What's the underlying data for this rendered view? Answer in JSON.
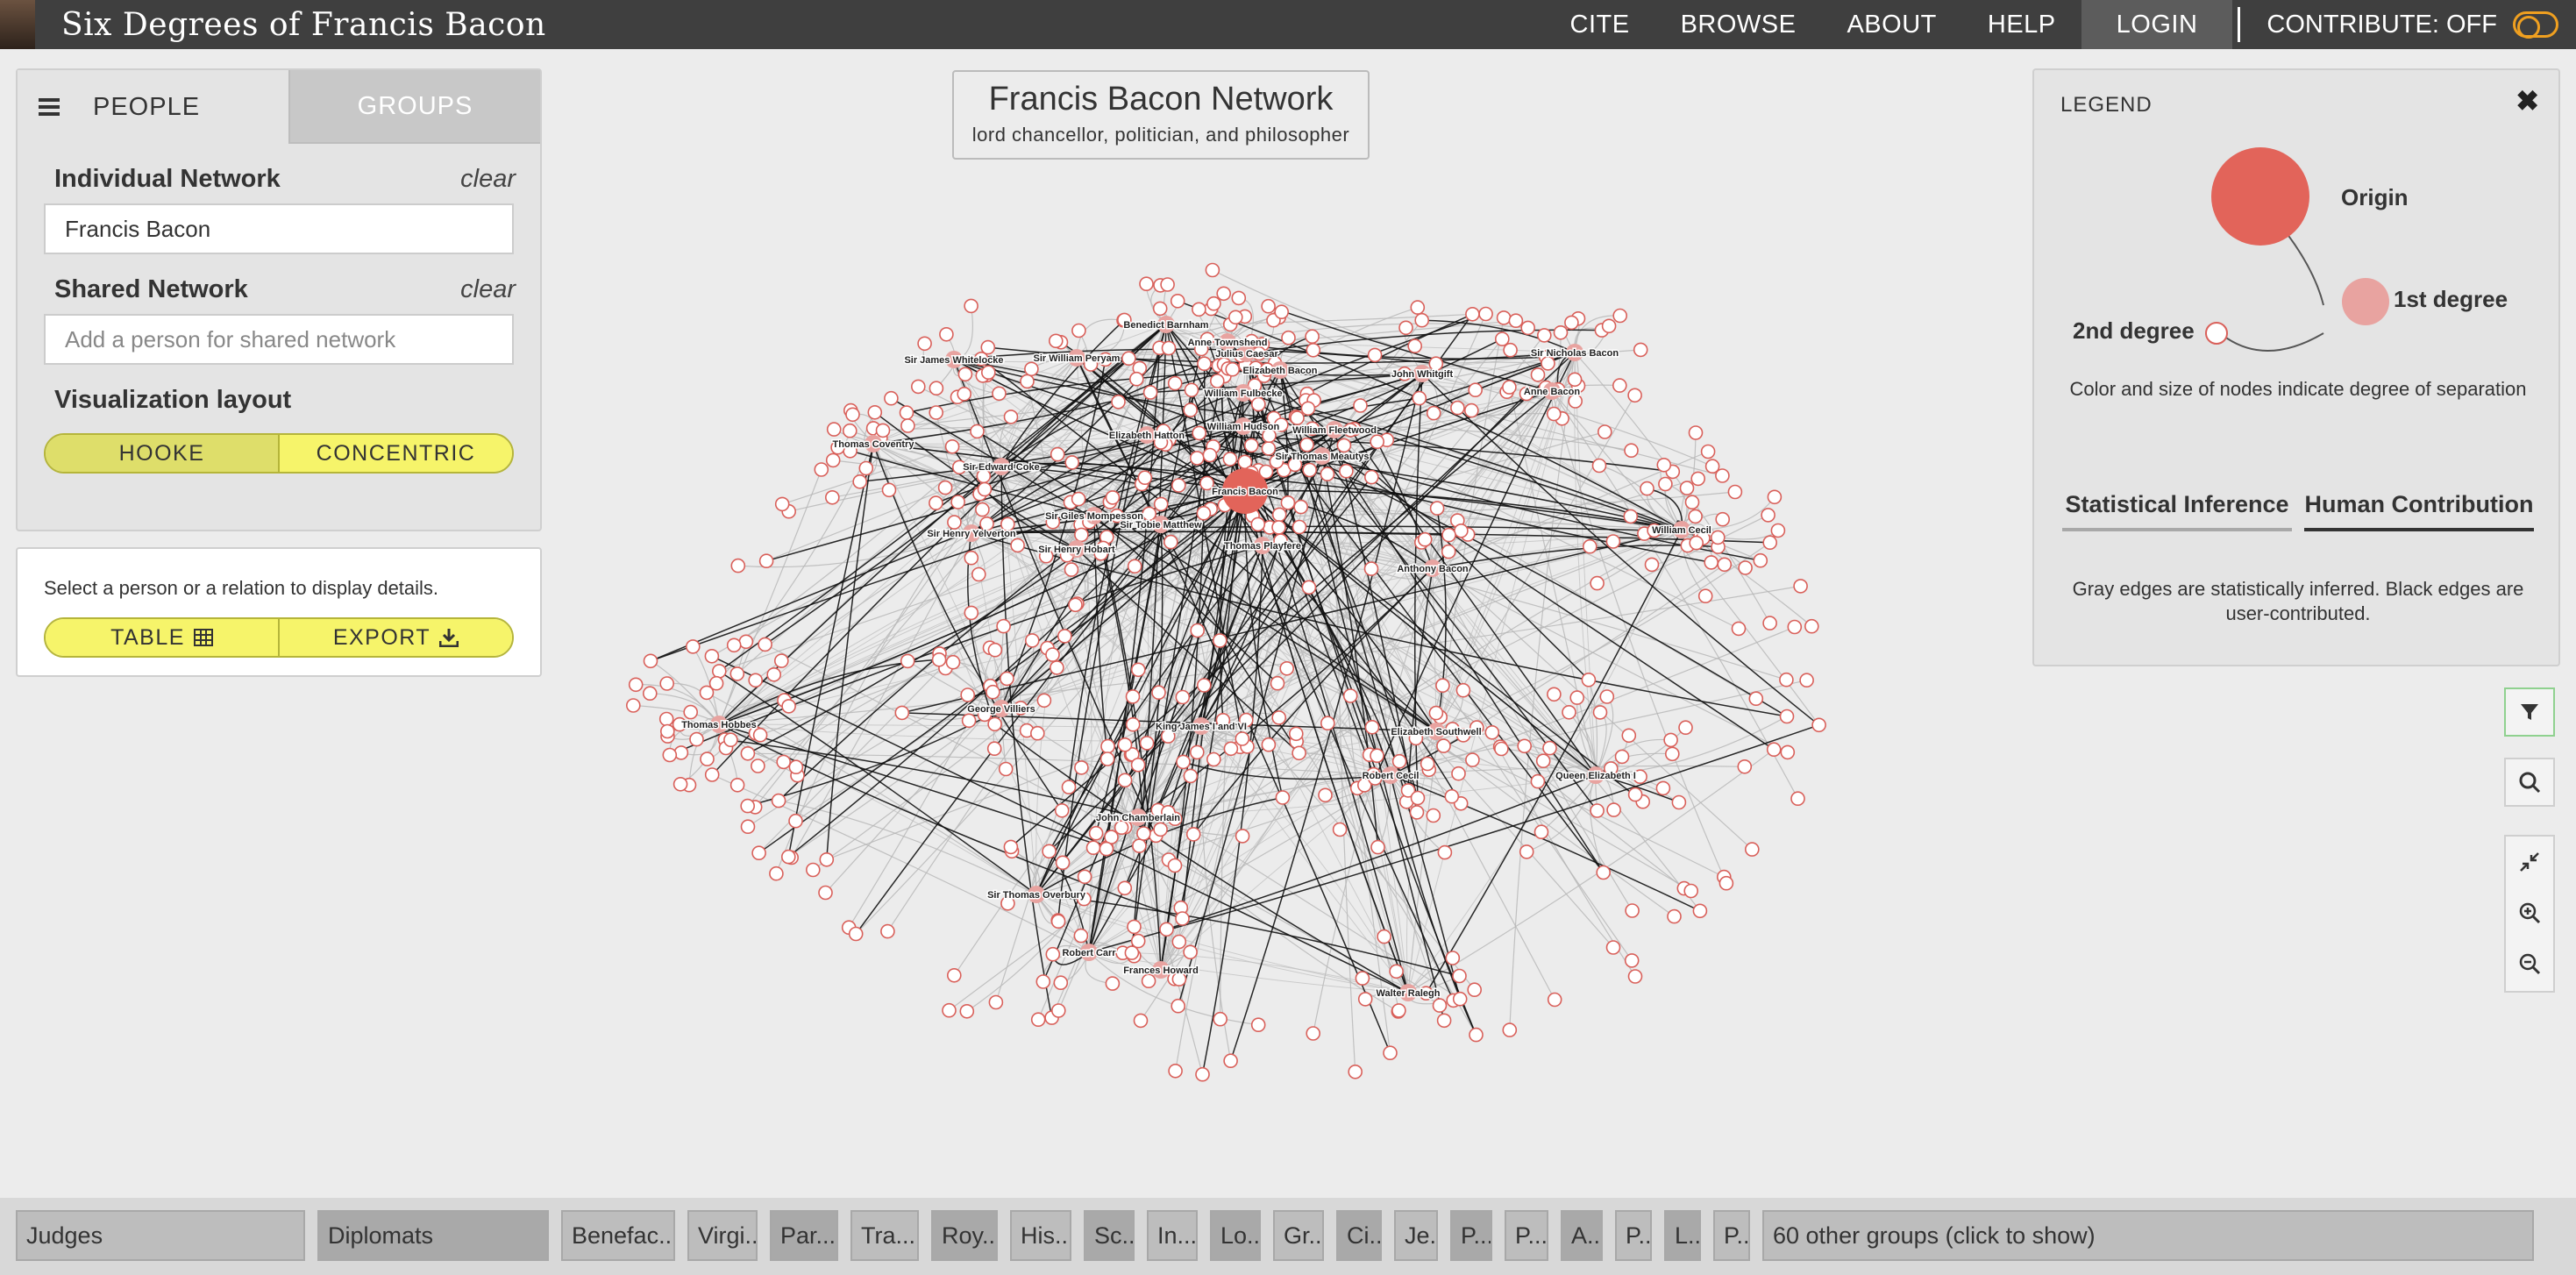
{
  "header": {
    "site_title": "Six Degrees of Francis Bacon",
    "nav": [
      "CITE",
      "BROWSE",
      "ABOUT",
      "HELP"
    ],
    "login": "LOGIN",
    "contribute": "CONTRIBUTE: OFF"
  },
  "left_panel": {
    "tabs": {
      "people": "PEOPLE",
      "groups": "GROUPS"
    },
    "individual_network": {
      "title": "Individual Network",
      "clear": "clear",
      "value": "Francis Bacon"
    },
    "shared_network": {
      "title": "Shared Network",
      "clear": "clear",
      "placeholder": "Add a person for shared network"
    },
    "visualization_layout": {
      "title": "Visualization layout",
      "options": [
        "HOOKE",
        "CONCENTRIC"
      ],
      "selected": "HOOKE"
    }
  },
  "detail_panel": {
    "text": "Select a person or a relation to display details.",
    "table_button": "TABLE",
    "export_button": "EXPORT"
  },
  "network": {
    "title": "Francis Bacon Network",
    "subtitle": "lord chancellor, politician, and philosopher",
    "labels": [
      "Benedict Barnham",
      "Anne Townshend",
      "Julius Caesar",
      "Elizabeth Bacon",
      "Sir James Whitelocke",
      "Sir William Peryam",
      "William Fulbecke",
      "John Whitgift",
      "Sir Nicholas Bacon",
      "Anne Bacon",
      "Thomas Coventry",
      "Elizabeth Hatton",
      "William Hudson",
      "William Fleetwood",
      "Sir Edward Coke",
      "Sir Thomas Meautys",
      "Francis Bacon",
      "Sir Giles Mompesson",
      "Sir Tobie Matthew",
      "Sir Henry Yelverton",
      "Thomas Playfere",
      "William Cecil",
      "Sir Henry Hobart",
      "Anthony Bacon",
      "Thomas Hobbes",
      "George Villiers",
      "King James I and VI",
      "Elizabeth Southwell",
      "Robert Cecil",
      "Queen Elizabeth I",
      "John Chamberlain",
      "Sir Thomas Overbury",
      "Robert Carr",
      "Frances Howard",
      "Walter Ralegh"
    ]
  },
  "legend": {
    "title": "LEGEND",
    "close": "✖",
    "origin": "Origin",
    "first_degree": "1st degree",
    "second_degree": "2nd degree",
    "node_note": "Color and size of nodes indicate degree of separation",
    "tab_statistical": "Statistical Inference",
    "tab_human": "Human Contribution",
    "edge_note": "Gray edges are statistically inferred. Black edges are user-contributed.",
    "colors": {
      "origin": "#e2645a",
      "first": "#e8a3a0",
      "second": "#ffffff",
      "node_stroke": "#d9605a"
    }
  },
  "groups_bar": {
    "chips": [
      "Judges",
      "Diplomats",
      "Benefac...",
      "Virgi...",
      "Par...",
      "Tra...",
      "Roy...",
      "His...",
      "Sc...",
      "In...",
      "Lo...",
      "Gr...",
      "Ci...",
      "Je...",
      "P...",
      "P...",
      "A...",
      "P...",
      "L...",
      "P..."
    ],
    "other": "60 other groups (click to show)"
  }
}
